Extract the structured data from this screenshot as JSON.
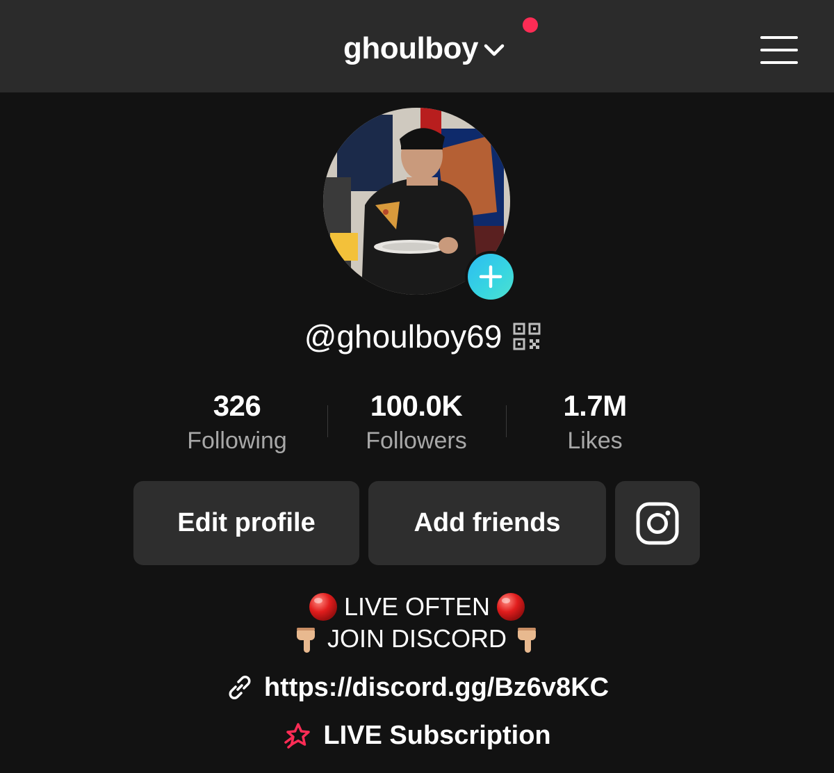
{
  "header": {
    "account_name": "ghoulboy",
    "chevron_icon": "chevron-down-icon",
    "notification_dot_color": "#fe2c55",
    "menu_icon": "hamburger-menu-icon"
  },
  "profile": {
    "avatar_alt": "profile photo",
    "add_avatar_icon": "plus-icon",
    "handle": "@ghoulboy69",
    "qr_icon": "qr-code-icon"
  },
  "stats": [
    {
      "value": "326",
      "label": "Following"
    },
    {
      "value": "100.0K",
      "label": "Followers"
    },
    {
      "value": "1.7M",
      "label": "Likes"
    }
  ],
  "actions": {
    "edit_profile": "Edit profile",
    "add_friends": "Add friends",
    "instagram_icon": "instagram-icon"
  },
  "bio": {
    "line1": "LIVE OFTEN",
    "line1_emoji": "red-circle",
    "line2": "JOIN DISCORD",
    "line2_emoji": "backhand-index-pointing-down"
  },
  "link": {
    "icon": "link-icon",
    "url": "https://discord.gg/Bz6v8KC"
  },
  "subscription": {
    "icon": "star-badge-icon",
    "label": "LIVE Subscription",
    "icon_color": "#fe2c55"
  }
}
